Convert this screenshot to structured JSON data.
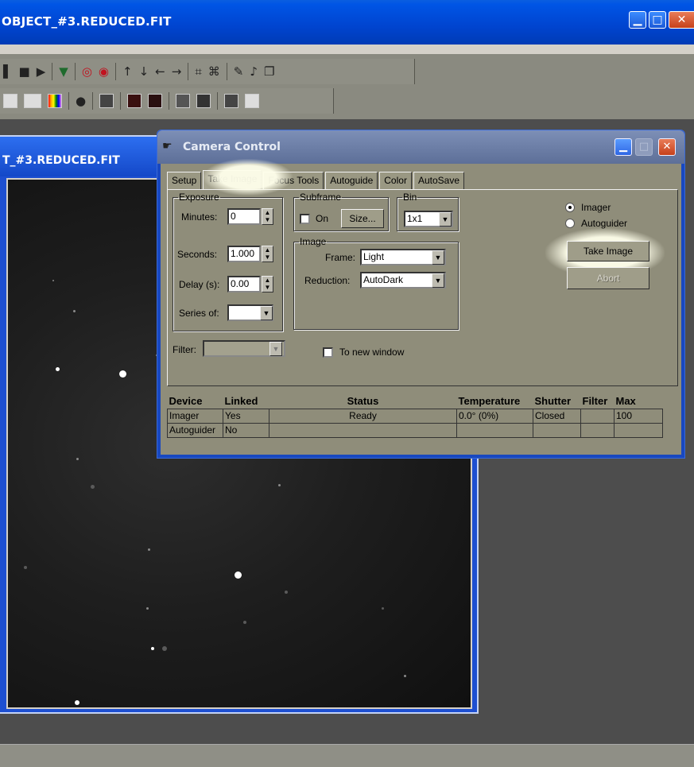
{
  "app": {
    "title": "OBJECT_#3.REDUCED.FIT"
  },
  "image_window": {
    "title": "T_#3.REDUCED.FIT"
  },
  "dialog": {
    "title": "Camera Control",
    "tabs": [
      "Setup",
      "Take Image",
      "Focus Tools",
      "Autoguide",
      "Color",
      "AutoSave"
    ],
    "active_tab": "Take Image",
    "exposure": {
      "legend": "Exposure",
      "minutes_label": "Minutes:",
      "minutes_value": "0",
      "seconds_label": "Seconds:",
      "seconds_value": "1.000",
      "delay_label": "Delay (s):",
      "delay_value": "0.00",
      "series_label": "Series of:",
      "series_value": ""
    },
    "subframe": {
      "legend": "Subframe",
      "on_label": "On",
      "on_checked": false,
      "size_button": "Size..."
    },
    "bin": {
      "legend": "Bin",
      "value": "1x1"
    },
    "image": {
      "legend": "Image",
      "frame_label": "Frame:",
      "frame_value": "Light",
      "reduction_label": "Reduction:",
      "reduction_value": "AutoDark"
    },
    "filter": {
      "label": "Filter:",
      "value": ""
    },
    "to_new_window": {
      "label": "To new window",
      "checked": false
    },
    "mode": {
      "imager_label": "Imager",
      "autoguider_label": "Autoguider",
      "selected": "Imager"
    },
    "take_image_button": "Take Image",
    "abort_button": "Abort",
    "devices": {
      "columns": [
        "Device",
        "Linked",
        "Status",
        "Temperature",
        "Shutter",
        "Filter",
        "Max"
      ],
      "rows": [
        [
          "Imager",
          "Yes",
          "Ready",
          "0.0° (0%)",
          "Closed",
          "",
          "100"
        ],
        [
          "Autoguider",
          "No",
          "",
          "",
          "",
          "",
          ""
        ]
      ]
    }
  },
  "colors": {
    "titlebar": "#0044cf",
    "dialog_body": "#8f8d7a",
    "dialog_title": "#6b7ca4",
    "highlight": "#fffbe0"
  }
}
